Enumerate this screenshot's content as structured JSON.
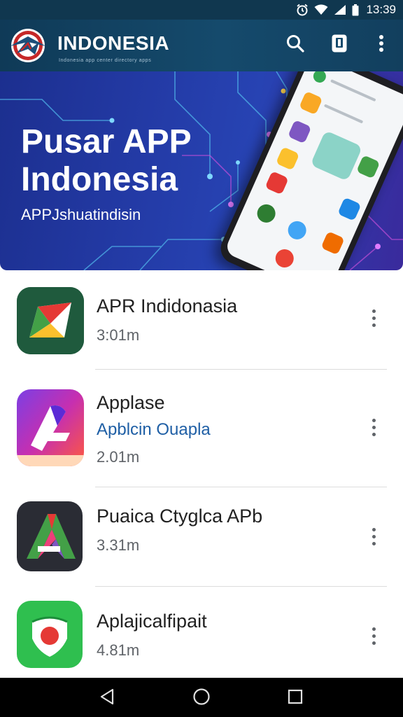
{
  "status_bar": {
    "time": "13:39"
  },
  "app_bar": {
    "title": "INDONESIA",
    "subtitle": "Indonesia app center directory apps"
  },
  "banner": {
    "title_line1": "Pusar APP",
    "title_line2": "Indonesia",
    "subtitle": "APPJshuatindisin"
  },
  "apps": [
    {
      "name": "APR Indidonasia",
      "description": "",
      "size": "3:01m"
    },
    {
      "name": "Applase",
      "description": "Apblcin Ouapla",
      "size": "2.01m"
    },
    {
      "name": "Puaica Ctyglca APb",
      "description": "",
      "size": "3.31m"
    },
    {
      "name": "Aplajicalfipait",
      "description": "",
      "size": "4.81m"
    }
  ],
  "icons": {
    "status": [
      "alarm-icon",
      "wifi-icon",
      "signal-icon",
      "battery-icon"
    ],
    "app_bar": [
      "search-icon",
      "phone-icon",
      "more-vert-icon"
    ],
    "nav": [
      "back-icon",
      "home-icon",
      "recents-icon"
    ]
  },
  "colors": {
    "app_bar": "#154a6c",
    "banner": "#2743b3",
    "description_link": "#1f5fa5"
  }
}
